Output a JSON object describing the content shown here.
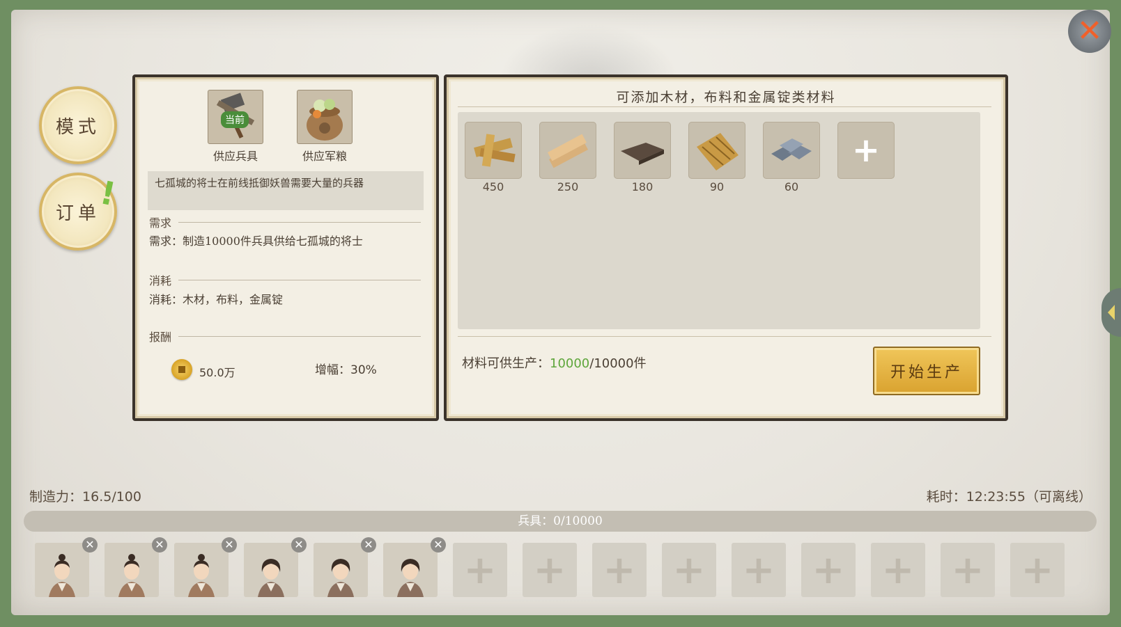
{
  "nav": {
    "mode_label": "模式",
    "orders_label": "订单",
    "orders_alert": "!"
  },
  "left_panel": {
    "tabs": [
      {
        "label": "供应兵具",
        "badge": "当前",
        "icon": "weapon-bundle-icon"
      },
      {
        "label": "供应军粮",
        "icon": "grain-sack-icon"
      }
    ],
    "description": "七孤城的将士在前线抵御妖兽需要大量的兵器",
    "requirement_header": "需求",
    "requirement_text": "需求：制造10000件兵具供给七孤城的将士",
    "consume_header": "消耗",
    "consume_text": "消耗：木材，布料，金属锭",
    "reward_header": "报酬",
    "reward_amount": "50.0万",
    "bonus_label": "增幅：",
    "bonus_value": "30%"
  },
  "right_panel": {
    "title": "可添加木材，布料和金属锭类材料",
    "materials": [
      {
        "icon": "wood-planks-icon",
        "count": "450"
      },
      {
        "icon": "lumber-boards-icon",
        "count": "250"
      },
      {
        "icon": "cloth-icon",
        "count": "180"
      },
      {
        "icon": "fiber-bundle-icon",
        "count": "90"
      },
      {
        "icon": "metal-ingot-icon",
        "count": "60"
      }
    ],
    "add_symbol": "+",
    "supply_label": "材料可供生产：",
    "supply_available": "10000",
    "supply_total": "/10000件",
    "start_button": "开始生产"
  },
  "footer": {
    "craft_power_label": "制造力：",
    "craft_power_value": "16.5/100",
    "time_label": "耗时：",
    "time_value": "12:23:55",
    "offline_note": "（可离线）",
    "progress_label": "兵具：0/10000",
    "progress_fraction": 0
  },
  "workers": [
    {
      "icon": "worker-male-portrait"
    },
    {
      "icon": "worker-male-portrait"
    },
    {
      "icon": "worker-male-portrait"
    },
    {
      "icon": "worker-female-portrait"
    },
    {
      "icon": "worker-female-portrait"
    },
    {
      "icon": "worker-female-portrait"
    }
  ],
  "empty_slots": 9,
  "colors": {
    "accent_green": "#5ea63b",
    "panel_border": "#3b332b",
    "close_orange": "#f0602a",
    "button_gold": "#d9a22f"
  }
}
